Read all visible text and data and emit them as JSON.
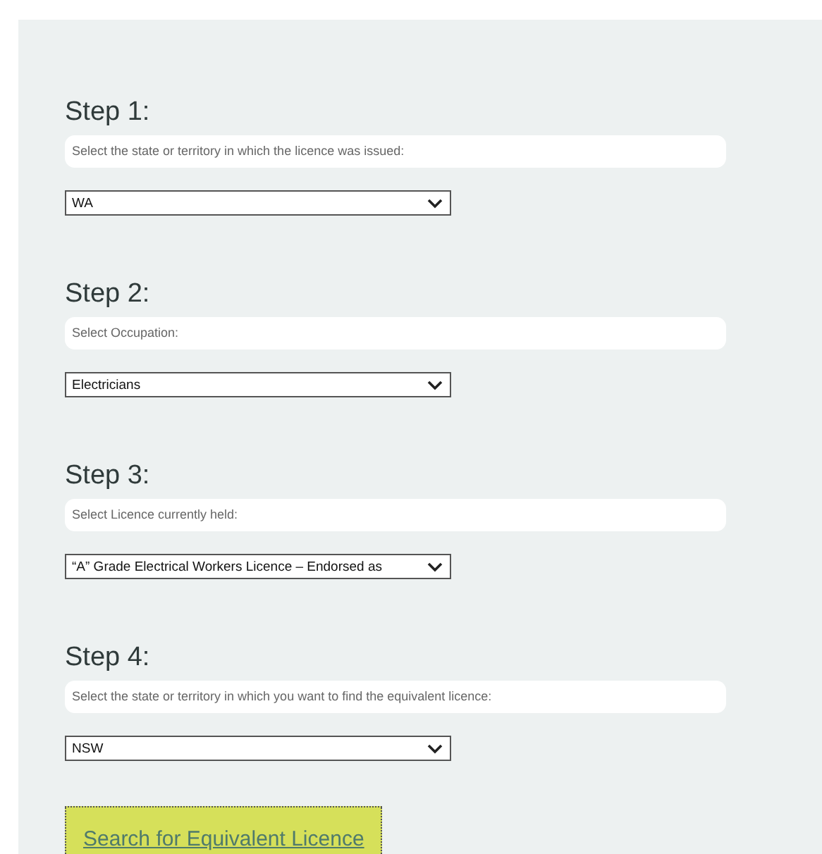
{
  "steps": [
    {
      "heading": "Step 1:",
      "instruction": "Select the state or territory in which the licence was issued:",
      "value": "WA"
    },
    {
      "heading": "Step 2:",
      "instruction": "Select Occupation:",
      "value": "Electricians"
    },
    {
      "heading": "Step 3:",
      "instruction": "Select Licence currently held:",
      "value": "“A” Grade Electrical Workers Licence – Endorsed as"
    },
    {
      "heading": "Step 4:",
      "instruction": "Select the state or territory in which you want to find the equivalent licence:",
      "value": "NSW"
    }
  ],
  "search_button": {
    "label": "Search for Equivalent Licence"
  }
}
